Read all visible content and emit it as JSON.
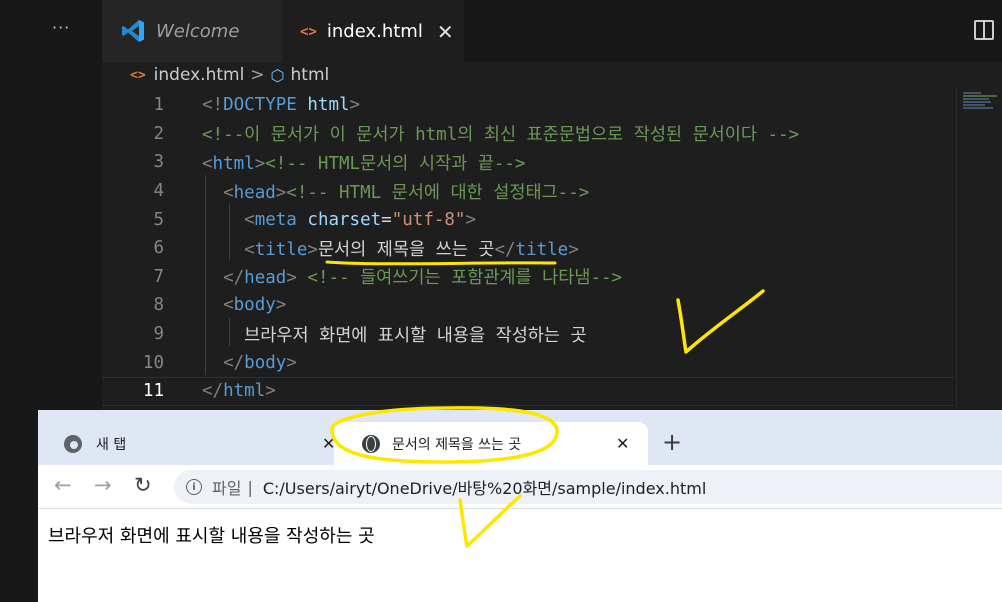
{
  "editor": {
    "more_label": "···",
    "tabs": [
      {
        "label": "Welcome",
        "icon": "vscode-logo-icon"
      },
      {
        "label": "index.html",
        "icon": "html-file-icon",
        "close": "✕"
      }
    ],
    "file_icon_glyph": "<>",
    "breadcrumb": {
      "file": "index.html",
      "sep": ">",
      "symbol": "html"
    },
    "lines": [
      {
        "n": "1"
      },
      {
        "n": "2"
      },
      {
        "n": "3"
      },
      {
        "n": "4"
      },
      {
        "n": "5"
      },
      {
        "n": "6"
      },
      {
        "n": "7"
      },
      {
        "n": "8"
      },
      {
        "n": "9"
      },
      {
        "n": "10"
      },
      {
        "n": "11"
      }
    ],
    "code": {
      "l1": {
        "open": "<!",
        "kw": "DOCTYPE",
        "name": "html",
        "close": ">"
      },
      "l2": {
        "comment": "<!--이 문서가 이 문서가 html의 최신 표준문법으로 작성된 문서이다 -->"
      },
      "l3": {
        "lt": "<",
        "tag": "html",
        "gt": ">",
        "comment": "<!-- HTML문서의 시작과 끝-->"
      },
      "l4": {
        "lt": "<",
        "tag": "head",
        "gt": ">",
        "comment": "<!-- HTML 문서에 대한 설정태그-->"
      },
      "l5": {
        "lt": "<",
        "tag": "meta",
        "attr": "charset",
        "eq": "=",
        "val": "\"utf-8\"",
        "gt": ">"
      },
      "l6": {
        "lt": "<",
        "tag": "title",
        "gt": ">",
        "text": "문서의 제목을 쓰는 곳",
        "clt": "</",
        "ctag": "title",
        "cgt": ">"
      },
      "l7": {
        "lt": "</",
        "tag": "head",
        "gt": ">",
        "comment": "<!-- 들여쓰기는 포함관계를 나타냄-->"
      },
      "l8": {
        "lt": "<",
        "tag": "body",
        "gt": ">"
      },
      "l9": {
        "text": "브라우저 화면에 표시할 내용을 작성하는 곳"
      },
      "l10": {
        "lt": "</",
        "tag": "body",
        "gt": ">"
      },
      "l11": {
        "lt": "</",
        "tag": "html",
        "gt": ">"
      }
    }
  },
  "browser": {
    "tabs": [
      {
        "label": "새 탭",
        "close": "✕"
      },
      {
        "label": "문서의 제목을 쓰는 곳",
        "close": "✕"
      }
    ],
    "new_tab": "+",
    "nav": {
      "back": "←",
      "forward": "→",
      "reload": "↻"
    },
    "address": {
      "info": "i",
      "label": "파일",
      "sep": "|",
      "url": "C:/Users/airyt/OneDrive/바탕%20화면/sample/index.html"
    },
    "page_text": "브라우저 화면에 표시할 내용을 작성하는 곳"
  },
  "colors": {
    "annotation": "#ffe600",
    "tag": "#569cd6",
    "comment": "#6a9955",
    "string": "#ce9178",
    "attr": "#9cdcfe"
  }
}
